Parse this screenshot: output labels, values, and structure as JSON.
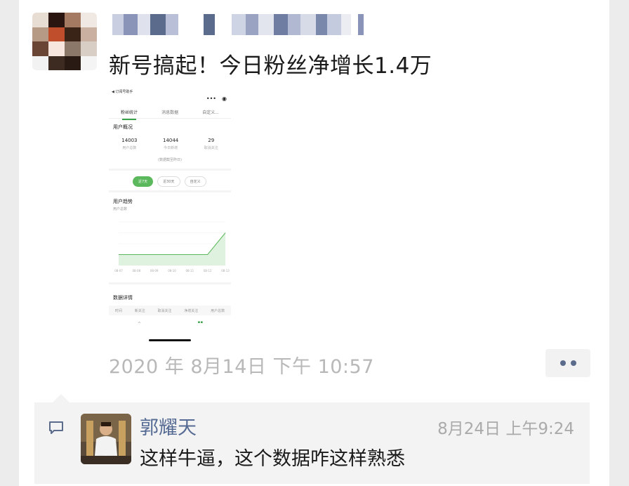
{
  "post": {
    "text": "新号搞起！今日粉丝净增长1.4万",
    "time": "2020 年 8月14日 下午 10:57"
  },
  "screenshot": {
    "header": "◀ 订阅号助手",
    "tabs": [
      "粉丝统计",
      "消息数据",
      "自定义..."
    ],
    "overview_title": "用户概况",
    "stats": [
      {
        "value": "14003",
        "label": "用户总数"
      },
      {
        "value": "14044",
        "label": "今日新增"
      },
      {
        "value": "29",
        "label": "取消关注"
      }
    ],
    "note": "(数据截至昨日)",
    "filters": [
      "近7天",
      "近30天",
      "自定义"
    ],
    "trend_title": "用户趋势",
    "trend_select": "用户总数",
    "chart_data": {
      "type": "line",
      "x": [
        "08-07",
        "08-08",
        "08-09",
        "08-10",
        "08-11",
        "08-12",
        "08-13"
      ],
      "values": [
        20,
        20,
        20,
        20,
        20,
        20,
        60
      ]
    },
    "table_title": "数据详情",
    "table_headers": [
      "时间",
      "新关注",
      "取消关注",
      "净增关注",
      "用户总数"
    ],
    "bottom_tabs": [
      "首页",
      "统计"
    ]
  },
  "comment": {
    "author": "郭耀天",
    "time": "8月24日 上午9:24",
    "text": "这样牛逼，这个数据咋这样熟悉"
  },
  "colors": {
    "link_blue": "#566b94",
    "wechat_green": "#5cb85c",
    "comment_bg": "#f3f3f3"
  }
}
